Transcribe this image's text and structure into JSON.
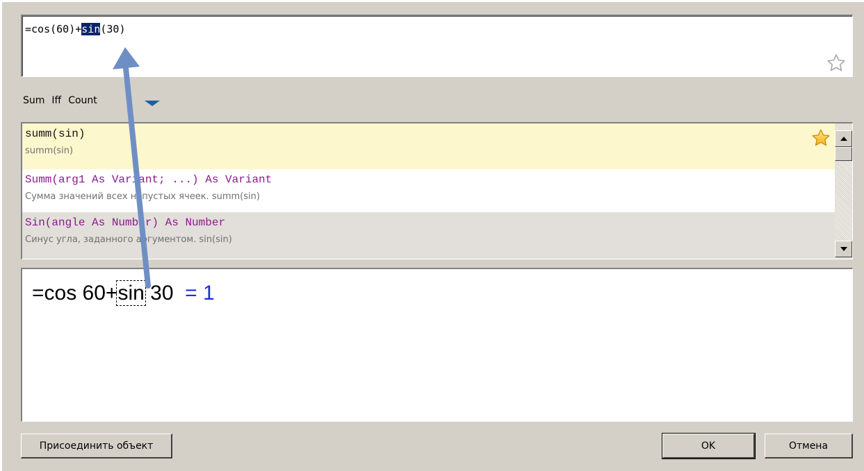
{
  "formula_editor": {
    "prefix": "=cos(60)+",
    "selected": "sin",
    "suffix": "(30)",
    "favorite_icon": "star-outline-icon"
  },
  "quick_functions": {
    "items": [
      "Sum",
      "Iff",
      "Count"
    ],
    "more_icon": "dropdown-arrow-icon"
  },
  "suggestions": {
    "items": [
      {
        "signature": "summ(sin)",
        "description": "summ(sin)",
        "favorite_icon": "star-filled-icon"
      },
      {
        "signature": "Summ(arg1 As Variant; ...) As Variant",
        "description": "Сумма значений всех непустых ячеек. summ(sin)"
      },
      {
        "signature": "Sin(angle As Number) As Number",
        "description": "Синус угла, заданного аргументом. sin(sin)"
      }
    ]
  },
  "preview": {
    "prefix": "=cos 60+",
    "focused": "sin",
    "suffix": " 30  ",
    "result": "= 1"
  },
  "buttons": {
    "attach": "Присоединить объект",
    "ok": "OK",
    "cancel": "Отмена"
  },
  "colors": {
    "dialog_bg": "#d4d0c8",
    "selection_bg": "#0a246a",
    "highlight_row": "#fdf7cd",
    "signature_purple": "#8b1a8b",
    "result_blue": "#1c2cd8",
    "annotation_arrow": "#6f8fc4"
  }
}
